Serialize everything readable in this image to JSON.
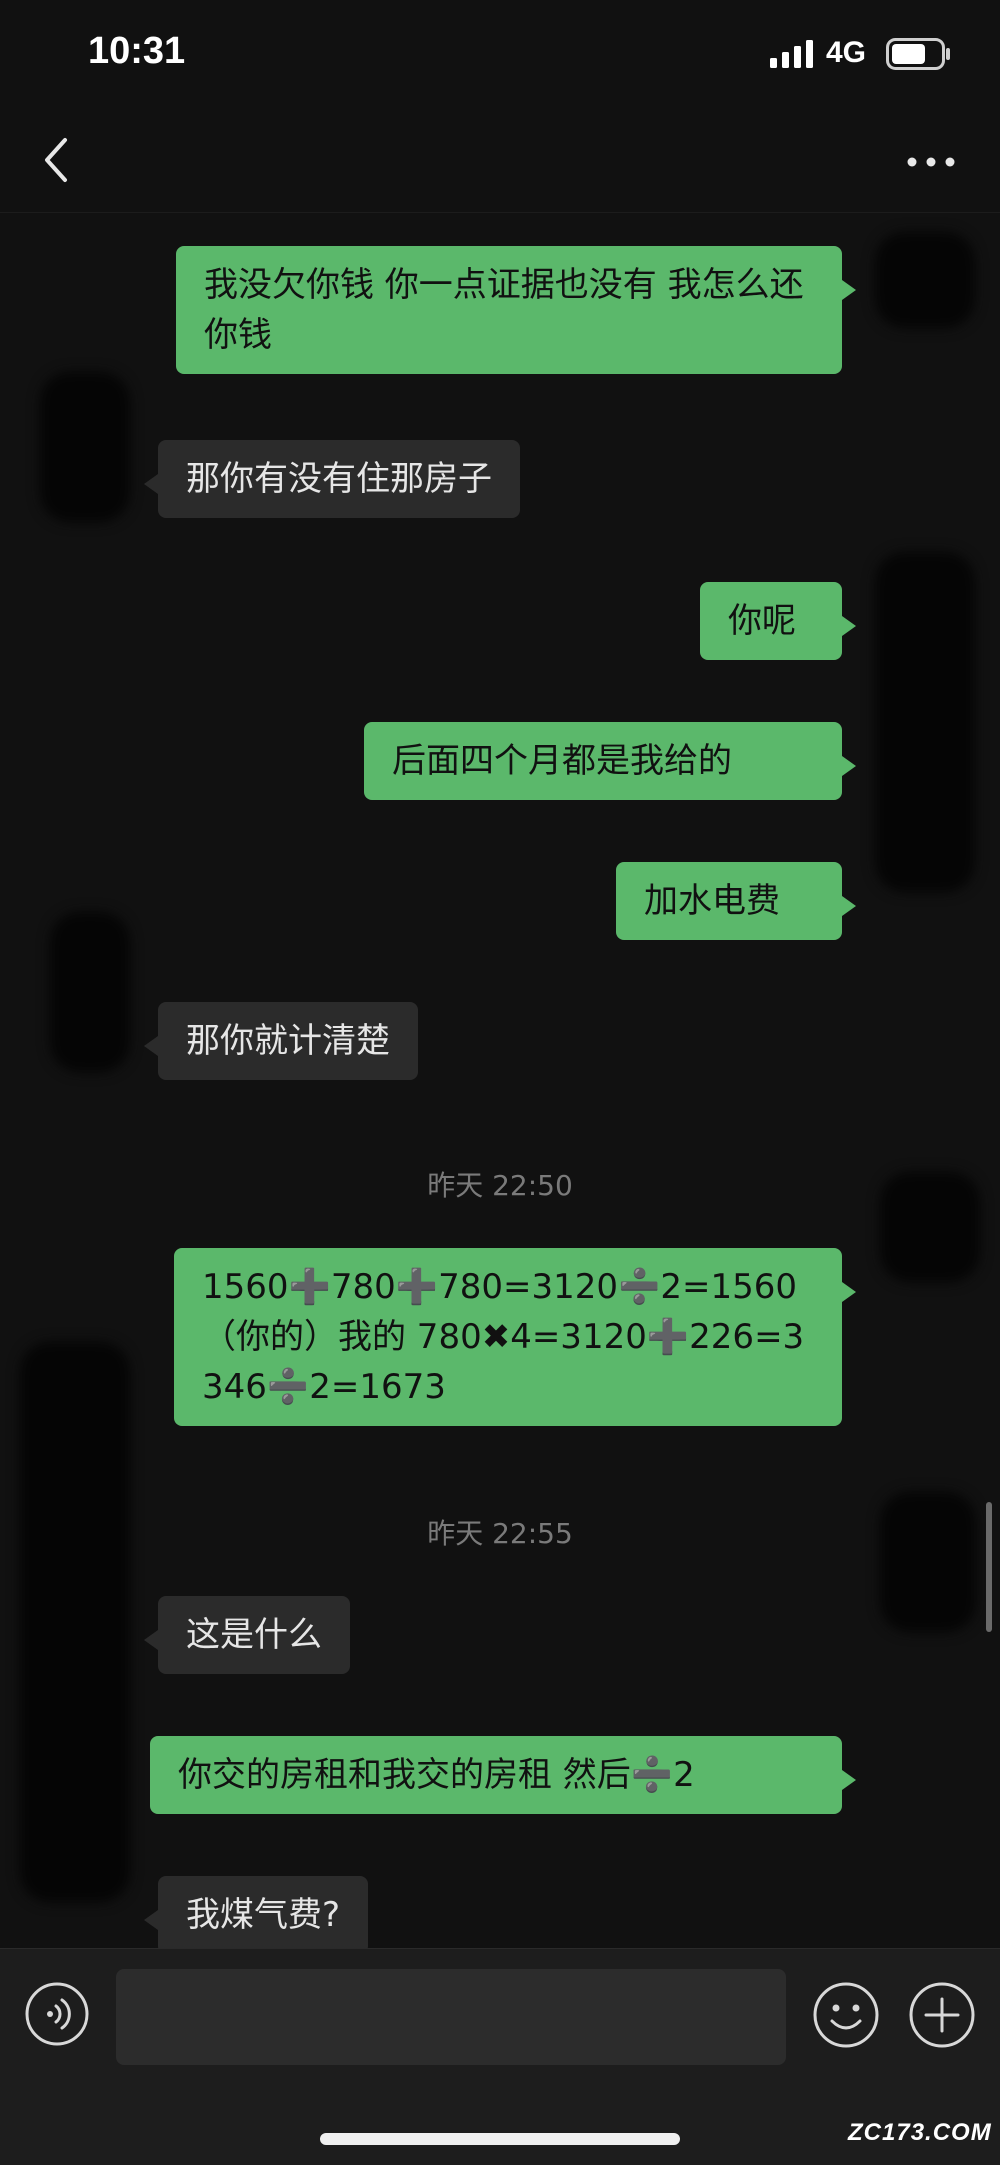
{
  "status_bar": {
    "time": "10:31",
    "network": "4G",
    "icons": [
      "signal-icon",
      "battery-icon"
    ]
  },
  "nav": {
    "icons": [
      "back-chevron-icon",
      "more-dots-icon"
    ]
  },
  "colors": {
    "sent_bubble": "#5bb86b",
    "received_bubble": "#2b2b2b",
    "background": "#111111"
  },
  "messages": [
    {
      "direction": "sent",
      "text": "我没欠你钱 你一点证据也没有 我怎么还你钱"
    },
    {
      "direction": "received",
      "text": "那你有没有住那房子"
    },
    {
      "direction": "sent",
      "text": "你呢"
    },
    {
      "direction": "sent",
      "text": "后面四个月都是我给的"
    },
    {
      "direction": "sent",
      "text": "加水电费"
    },
    {
      "direction": "received",
      "text": "那你就计清楚"
    },
    {
      "direction": "time",
      "text": "昨天 22:50"
    },
    {
      "direction": "sent",
      "text": "1560➕780➕780=3120➗2=1560 （你的）我的 780✖4=3120➕226=3346➗2=1673"
    },
    {
      "direction": "time",
      "text": "昨天 22:55"
    },
    {
      "direction": "received",
      "text": "这是什么"
    },
    {
      "direction": "sent",
      "text": "你交的房租和我交的房租 然后➗2"
    },
    {
      "direction": "received",
      "text": "我煤气费?"
    }
  ],
  "input_bar": {
    "placeholder": "",
    "icons": [
      "voice-icon",
      "emoji-icon",
      "add-icon"
    ]
  },
  "watermark": "ZC173.COM"
}
